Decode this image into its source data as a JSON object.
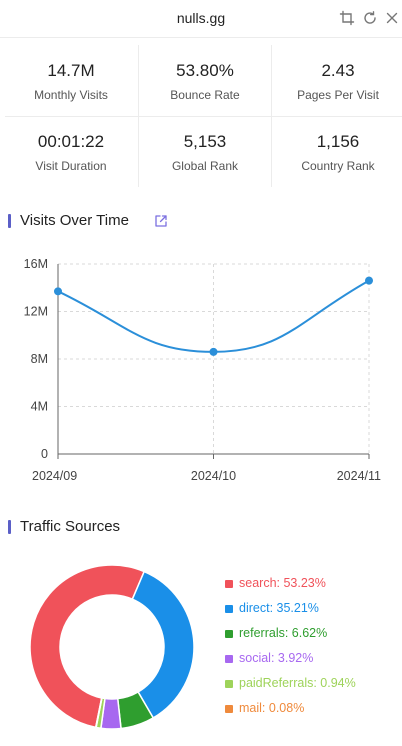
{
  "header": {
    "title": "nulls.gg"
  },
  "icons": {
    "crop": "crop-icon",
    "refresh": "refresh-icon",
    "close": "close-icon",
    "external": "external-link-icon"
  },
  "stats": [
    {
      "value": "14.7M",
      "label": "Monthly Visits"
    },
    {
      "value": "53.80%",
      "label": "Bounce Rate"
    },
    {
      "value": "2.43",
      "label": "Pages Per Visit"
    },
    {
      "value": "00:01:22",
      "label": "Visit Duration"
    },
    {
      "value": "5,153",
      "label": "Global Rank"
    },
    {
      "value": "1,156",
      "label": "Country Rank"
    }
  ],
  "visits_section": {
    "title": "Visits Over Time"
  },
  "traffic_section": {
    "title": "Traffic Sources"
  },
  "colors": {
    "accent_bar": "#5b5fc7",
    "line": "#2b8fd9",
    "search": "#f0525a",
    "direct": "#1a8fe8",
    "referrals": "#2f9e2f",
    "social": "#a768f0",
    "paidReferrals": "#9ed35a",
    "mail": "#ef8a3c"
  },
  "chart_data": [
    {
      "type": "line",
      "title": "Visits Over Time",
      "categories": [
        "2024/09",
        "2024/10",
        "2024/11"
      ],
      "series": [
        {
          "values": [
            13700000,
            8600000,
            14600000
          ]
        }
      ],
      "yticks": [
        "0",
        "4M",
        "8M",
        "12M",
        "16M"
      ],
      "ylim": [
        0,
        16000000
      ],
      "grid": true,
      "smooth": true
    },
    {
      "type": "pie",
      "title": "Traffic Sources",
      "donut": true,
      "legend": "right",
      "slices": [
        {
          "key": "search",
          "label": "search: 53.23%",
          "value": 53.23
        },
        {
          "key": "direct",
          "label": "direct: 35.21%",
          "value": 35.21
        },
        {
          "key": "referrals",
          "label": "referrals: 6.62%",
          "value": 6.62
        },
        {
          "key": "social",
          "label": "social: 3.92%",
          "value": 3.92
        },
        {
          "key": "paidReferrals",
          "label": "paidReferrals: 0.94%",
          "value": 0.94
        },
        {
          "key": "mail",
          "label": "mail: 0.08%",
          "value": 0.08
        }
      ]
    }
  ]
}
